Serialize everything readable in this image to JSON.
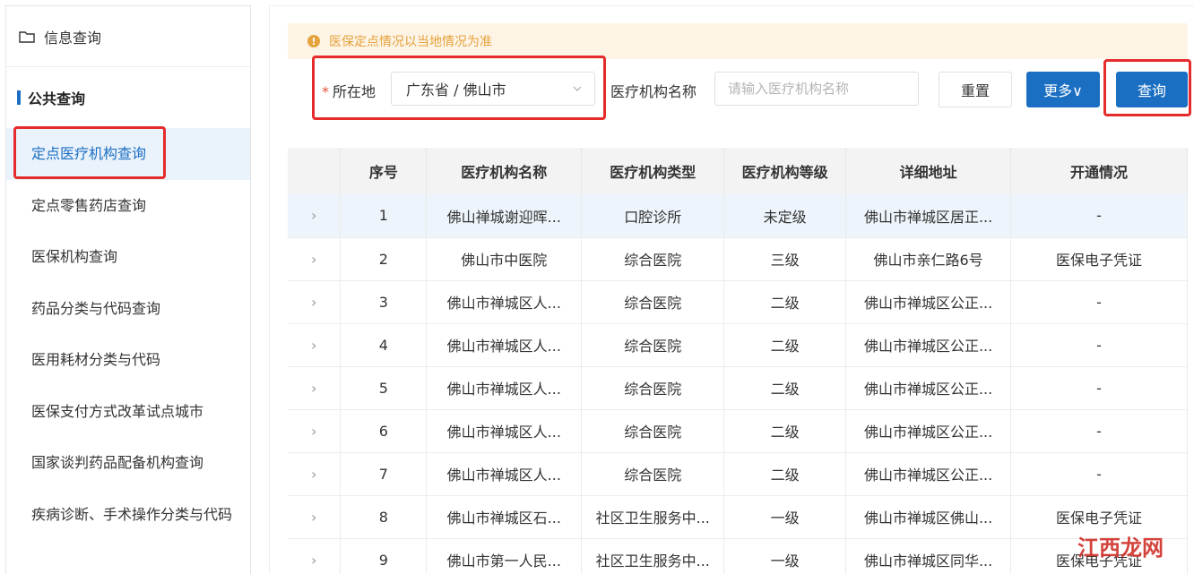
{
  "sidebar": {
    "header": "信息查询",
    "section": "公共查询",
    "items": [
      {
        "label": "定点医疗机构查询",
        "active": true
      },
      {
        "label": "定点零售药店查询",
        "active": false
      },
      {
        "label": "医保机构查询",
        "active": false
      },
      {
        "label": "药品分类与代码查询",
        "active": false
      },
      {
        "label": "医用耗材分类与代码",
        "active": false
      },
      {
        "label": "医保支付方式改革试点城市",
        "active": false
      },
      {
        "label": "国家谈判药品配备机构查询",
        "active": false
      },
      {
        "label": "疾病诊断、手术操作分类与代码",
        "active": false
      }
    ]
  },
  "notice": {
    "icon": "warning-icon",
    "text": "医保定点情况以当地情况为准"
  },
  "filters": {
    "required_mark": "*",
    "location_label": "所在地",
    "location_value": "广东省 / 佛山市",
    "name_label": "医疗机构名称",
    "name_placeholder": "请输入医疗机构名称",
    "reset": "重置",
    "more": "更多∨",
    "query": "查询"
  },
  "table": {
    "headers": [
      "",
      "序号",
      "医疗机构名称",
      "医疗机构类型",
      "医疗机构等级",
      "详细地址",
      "开通情况"
    ],
    "rows": [
      [
        "›",
        "1",
        "佛山禅城谢迎晖...",
        "口腔诊所",
        "未定级",
        "佛山市禅城区居正...",
        "-"
      ],
      [
        "›",
        "2",
        "佛山市中医院",
        "综合医院",
        "三级",
        "佛山市亲仁路6号",
        "医保电子凭证"
      ],
      [
        "›",
        "3",
        "佛山市禅城区人...",
        "综合医院",
        "二级",
        "佛山市禅城区公正...",
        "-"
      ],
      [
        "›",
        "4",
        "佛山市禅城区人...",
        "综合医院",
        "二级",
        "佛山市禅城区公正...",
        "-"
      ],
      [
        "›",
        "5",
        "佛山市禅城区人...",
        "综合医院",
        "二级",
        "佛山市禅城区公正...",
        "-"
      ],
      [
        "›",
        "6",
        "佛山市禅城区人...",
        "综合医院",
        "二级",
        "佛山市禅城区公正...",
        "-"
      ],
      [
        "›",
        "7",
        "佛山市禅城区人...",
        "综合医院",
        "二级",
        "佛山市禅城区公正...",
        "-"
      ],
      [
        "›",
        "8",
        "佛山市禅城区石...",
        "社区卫生服务中...",
        "一级",
        "佛山市禅城区佛山...",
        "医保电子凭证"
      ],
      [
        "›",
        "9",
        "佛山市第一人民...",
        "社区卫生服务中...",
        "一级",
        "佛山市禅城区同华...",
        "医保电子凭证"
      ]
    ]
  },
  "watermark": "江西龙网",
  "colors": {
    "primary": "#1b6fc2",
    "highlight": "#e52b2b",
    "notice_text": "#e6a23c",
    "notice_bg": "#fdf4e6"
  }
}
